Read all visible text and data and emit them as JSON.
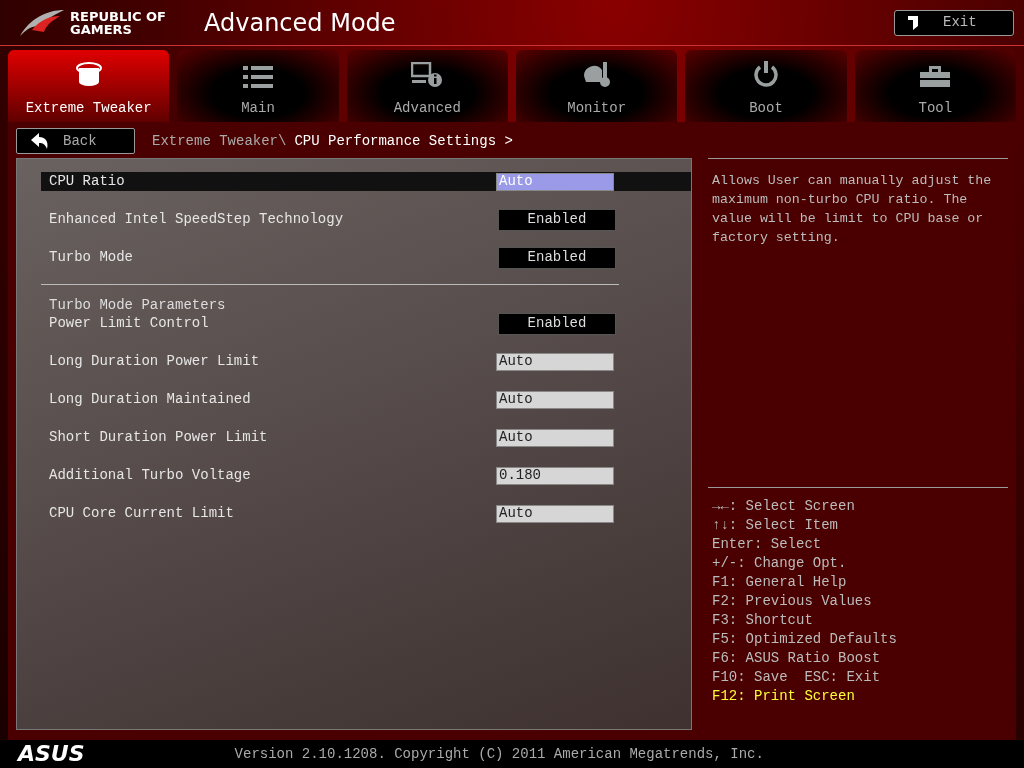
{
  "header": {
    "brand": [
      "REPUBLIC OF",
      "GAMERS"
    ],
    "title": "Advanced Mode",
    "exit_button": "Exit"
  },
  "tabs": [
    {
      "label": "Extreme Tweaker",
      "selected": true
    },
    {
      "label": "Main",
      "selected": false
    },
    {
      "label": "Advanced",
      "selected": false
    },
    {
      "label": "Monitor",
      "selected": false
    },
    {
      "label": "Boot",
      "selected": false
    },
    {
      "label": "Tool",
      "selected": false
    }
  ],
  "back_button": "Back",
  "breadcrumb": {
    "parent": "Extreme Tweaker\\",
    "current": "CPU Performance Settings >"
  },
  "settings": [
    {
      "label": "CPU Ratio",
      "value": "Auto",
      "kind": "input",
      "selected": true
    },
    {
      "label": "Enhanced Intel SpeedStep Technology",
      "value": "Enabled",
      "kind": "select",
      "selected": false
    },
    {
      "label": "Turbo Mode",
      "value": "Enabled",
      "kind": "select",
      "selected": false
    }
  ],
  "turbo_parameters": {
    "heading": "Turbo Mode Parameters",
    "settings": [
      {
        "label": "Power Limit Control",
        "value": "Enabled",
        "kind": "select",
        "selected": false
      },
      {
        "label": "Long Duration Power Limit",
        "value": "Auto",
        "kind": "input",
        "selected": false
      },
      {
        "label": "Long Duration Maintained",
        "value": "Auto",
        "kind": "input",
        "selected": false
      },
      {
        "label": "Short Duration Power Limit",
        "value": "Auto",
        "kind": "input",
        "selected": false
      },
      {
        "label": "Additional Turbo Voltage",
        "value": "0.180",
        "kind": "input",
        "selected": false
      },
      {
        "label": "CPU Core Current Limit",
        "value": "Auto",
        "kind": "input",
        "selected": false
      }
    ]
  },
  "help_text": "Allows User can manually adjust the maximum non-turbo CPU ratio. The value will be limit to CPU base or factory setting.",
  "key_help": [
    {
      "text": "→←: Select Screen",
      "highlighted": false
    },
    {
      "text": "↑↓: Select Item",
      "highlighted": false
    },
    {
      "text": "Enter: Select",
      "highlighted": false
    },
    {
      "text": "+/-: Change Opt.",
      "highlighted": false
    },
    {
      "text": "F1: General Help",
      "highlighted": false
    },
    {
      "text": "F2: Previous Values",
      "highlighted": false
    },
    {
      "text": "F3: Shortcut",
      "highlighted": false
    },
    {
      "text": "F5: Optimized Defaults",
      "highlighted": false
    },
    {
      "text": "F6: ASUS Ratio Boost",
      "highlighted": false
    },
    {
      "text": "F10: Save  ESC: Exit",
      "highlighted": false
    },
    {
      "text": "F12: Print Screen",
      "highlighted": true
    }
  ],
  "footer": {
    "logo": "ASUS",
    "version": "Version 2.10.1208. Copyright (C) 2011 American Megatrends, Inc."
  }
}
